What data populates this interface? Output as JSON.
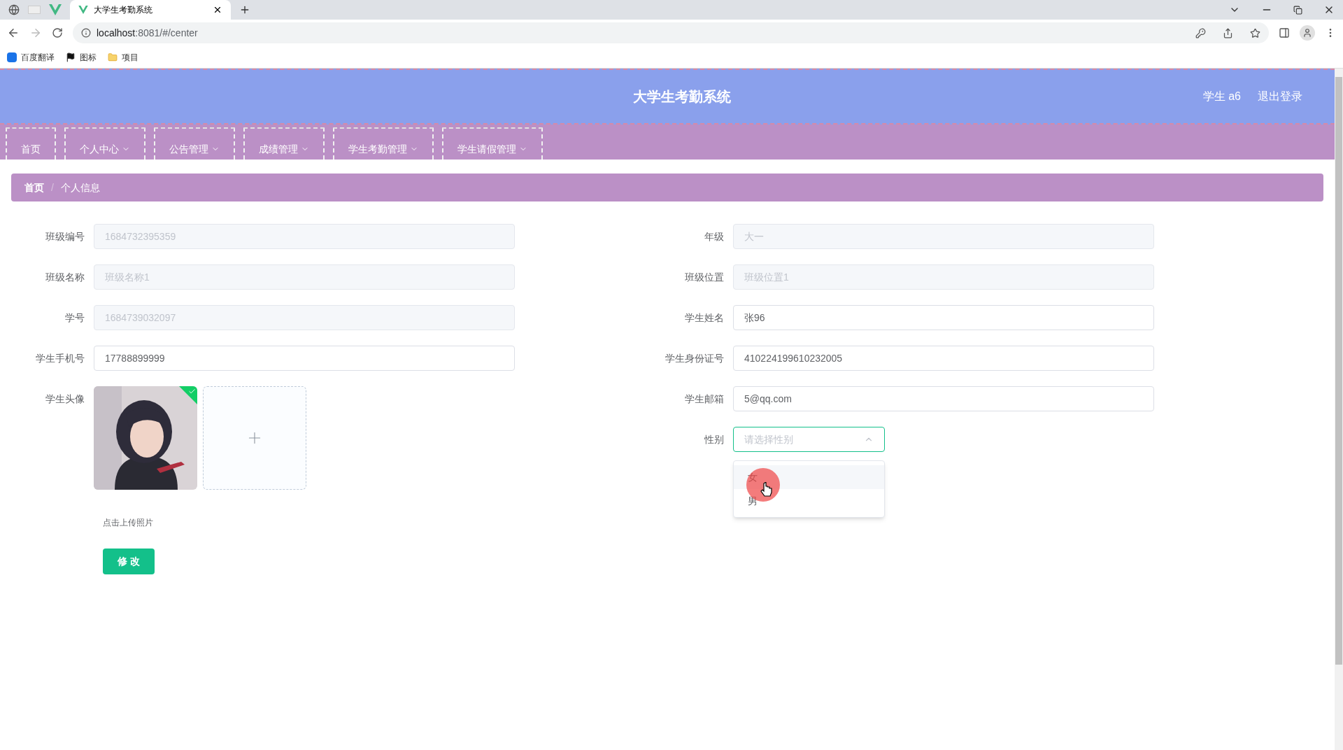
{
  "browser": {
    "tabs": [
      {
        "title": "大学生考勤系统",
        "selected": true
      }
    ],
    "url_host": "localhost",
    "url_rest": ":8081/#/center",
    "bookmarks": [
      "百度翻译",
      "图标",
      "项目"
    ]
  },
  "header": {
    "title": "大学生考勤系统",
    "user": "学生 a6",
    "logout": "退出登录"
  },
  "nav": [
    {
      "label": "首页",
      "dropdown": false
    },
    {
      "label": "个人中心",
      "dropdown": true
    },
    {
      "label": "公告管理",
      "dropdown": true
    },
    {
      "label": "成绩管理",
      "dropdown": true
    },
    {
      "label": "学生考勤管理",
      "dropdown": true
    },
    {
      "label": "学生请假管理",
      "dropdown": true
    }
  ],
  "breadcrumb": [
    "首页",
    "个人信息"
  ],
  "breadcrumb_separator": "/",
  "left_fields": [
    {
      "label": "班级编号",
      "value": "1684732395359",
      "disabled": true
    },
    {
      "label": "班级名称",
      "value": "班级名称1",
      "disabled": true
    },
    {
      "label": "学号",
      "value": "1684739032097",
      "disabled": true
    },
    {
      "label": "学生手机号",
      "value": "17788899999",
      "disabled": false
    }
  ],
  "avatar": {
    "label": "学生头像",
    "hint": "点击上传照片",
    "uploaded": true
  },
  "right_fields": [
    {
      "label": "年级",
      "value": "大一",
      "disabled": true
    },
    {
      "label": "班级位置",
      "value": "班级位置1",
      "disabled": true
    },
    {
      "label": "学生姓名",
      "value": "张96",
      "disabled": false
    },
    {
      "label": "学生身份证号",
      "value": "410224199610232005",
      "disabled": false
    },
    {
      "label": "学生邮箱",
      "value": "5@qq.com",
      "disabled": false
    }
  ],
  "gender": {
    "label": "性别",
    "placeholder": "请选择性别",
    "expanded": true,
    "options": [
      {
        "label": "女",
        "hovered": true
      },
      {
        "label": "男",
        "hovered": false
      }
    ]
  },
  "submit": "修 改"
}
